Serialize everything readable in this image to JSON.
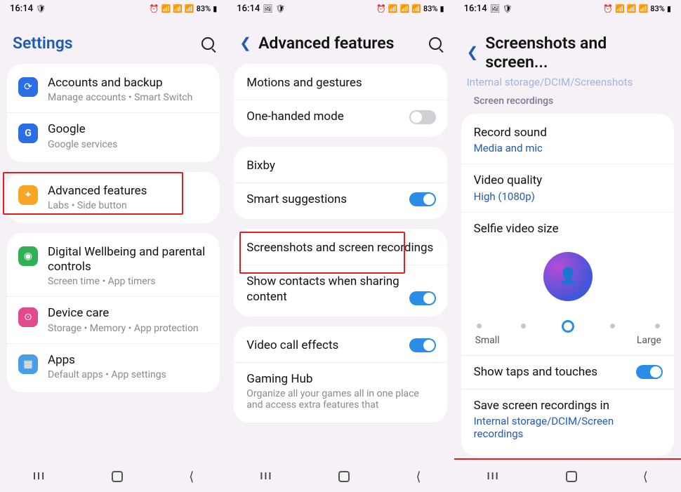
{
  "status": {
    "time": "16:14",
    "battery": "83%",
    "battery_icon": "▮"
  },
  "p1": {
    "title": "Settings",
    "rows": {
      "accounts": {
        "title": "Accounts and backup",
        "sub": "Manage accounts  •  Smart Switch"
      },
      "google": {
        "title": "Google",
        "sub": "Google services"
      },
      "advanced": {
        "title": "Advanced features",
        "sub": "Labs  •  Side button"
      },
      "wellbeing": {
        "title": "Digital Wellbeing and parental controls",
        "sub": "Screen time  •  App timers"
      },
      "devicecare": {
        "title": "Device care",
        "sub": "Storage  •  Memory  •  App protection"
      },
      "apps": {
        "title": "Apps",
        "sub": "Default apps  •  App settings"
      }
    }
  },
  "p2": {
    "title": "Advanced features",
    "rows": {
      "motions": "Motions and gestures",
      "onehand": "One-handed mode",
      "bixby": "Bixby",
      "smart": "Smart suggestions",
      "screenshots": "Screenshots and screen recordings",
      "sharecontacts": "Show contacts when sharing content",
      "videocall": "Video call effects",
      "gaming_title": "Gaming Hub",
      "gaming_sub": "Organize all your games all in one place and access extra features that"
    }
  },
  "p3": {
    "title": "Screenshots and screen...",
    "crumb": "Internal storage/DCIM/Screenshots",
    "section": "Screen recordings",
    "rows": {
      "recordsound": {
        "title": "Record sound",
        "value": "Media and mic"
      },
      "videoquality": {
        "title": "Video quality",
        "value": "High (1080p)"
      },
      "selfiesize": "Selfie video size",
      "slider_small": "Small",
      "slider_large": "Large",
      "showtaps": "Show taps and touches",
      "savein_title": "Save screen recordings in",
      "savein_value": "Internal storage/DCIM/Screen recordings"
    }
  }
}
